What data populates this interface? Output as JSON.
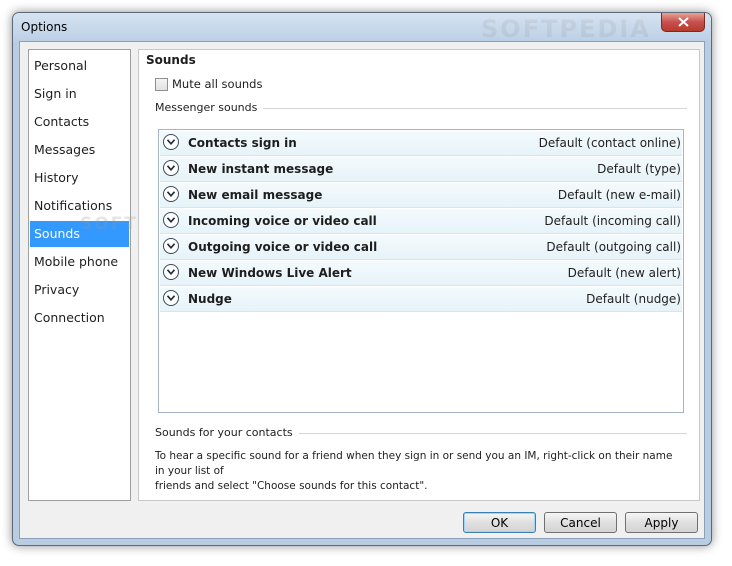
{
  "window": {
    "title": "Options"
  },
  "sidebar": {
    "items": [
      {
        "label": "Personal"
      },
      {
        "label": "Sign in"
      },
      {
        "label": "Contacts"
      },
      {
        "label": "Messages"
      },
      {
        "label": "History"
      },
      {
        "label": "Notifications"
      },
      {
        "label": "Sounds",
        "selected": true
      },
      {
        "label": "Mobile phone"
      },
      {
        "label": "Privacy"
      },
      {
        "label": "Connection"
      }
    ]
  },
  "sounds": {
    "title": "Sounds",
    "mute_label": "Mute all sounds",
    "mute_checked": false,
    "messenger_group": "Messenger sounds",
    "rows": [
      {
        "name": "Contacts sign in",
        "value": "Default (contact online)"
      },
      {
        "name": "New instant message",
        "value": "Default (type)"
      },
      {
        "name": "New email message",
        "value": "Default (new e-mail)"
      },
      {
        "name": "Incoming voice or video call",
        "value": "Default (incoming call)"
      },
      {
        "name": "Outgoing voice or video call",
        "value": "Default (outgoing call)"
      },
      {
        "name": "New Windows Live Alert",
        "value": "Default (new alert)"
      },
      {
        "name": "Nudge",
        "value": "Default (nudge)"
      }
    ],
    "contacts_group": "Sounds for your contacts",
    "contacts_text_line1": "To hear a specific sound for a friend when they sign in or send you an IM, right-click on their name in your list of",
    "contacts_text_line2": "friends and select \"Choose sounds for this contact\"."
  },
  "buttons": {
    "ok": "OK",
    "cancel": "Cancel",
    "apply": "Apply"
  },
  "watermark": "SOFTPEDIA",
  "colors": {
    "selection": "#3399ff",
    "frame": "#b9cde2",
    "close": "#c75050",
    "row_bg": "#e6f3f9"
  },
  "icons": {
    "close": "close-icon",
    "expand": "chevron-down-icon"
  }
}
